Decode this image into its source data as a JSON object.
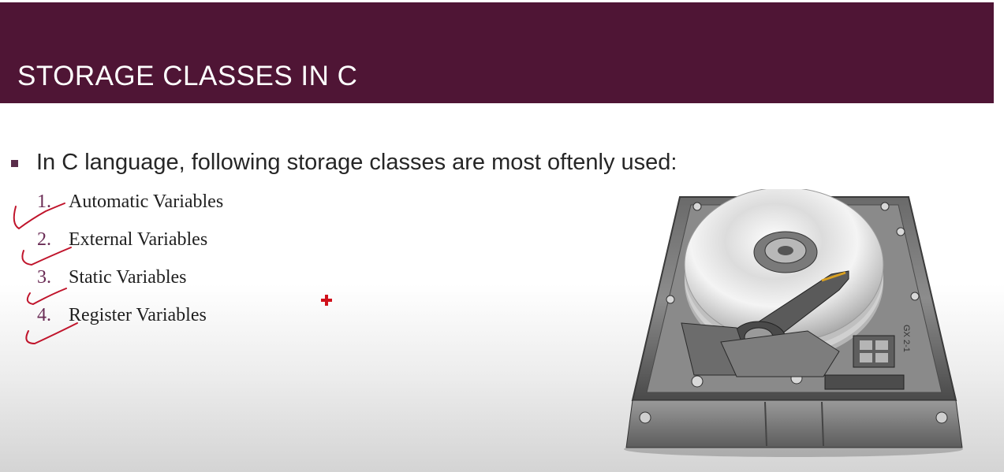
{
  "slide": {
    "title": "STORAGE CLASSES IN C",
    "bullet": "In C language, following storage classes are most oftenly used:",
    "items": [
      {
        "num": "1.",
        "label": "Automatic Variables"
      },
      {
        "num": "2.",
        "label": "External Variables"
      },
      {
        "num": "3.",
        "label": "Static Variables"
      },
      {
        "num": "4.",
        "label": "Register Variables"
      }
    ],
    "image_icon": "hard-drive-icon",
    "hdd_label": "GX 2-1"
  },
  "colors": {
    "title_bar": "#4f1535",
    "title_text": "#ffffff",
    "number_color": "#6a2c55",
    "annotation": "#c0142b"
  }
}
